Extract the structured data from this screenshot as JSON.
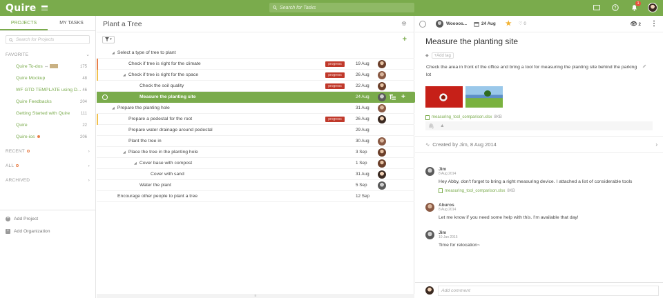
{
  "app": {
    "logo": "Quire",
    "search_placeholder": "Search for Tasks",
    "notification_count": "1"
  },
  "colors": {
    "brand": "#7aab4c",
    "progress_tag": "#c0392b",
    "favorite_dot": "#e8804a"
  },
  "sidebar": {
    "tabs": [
      "PROJECTS",
      "MY TASKS"
    ],
    "search_placeholder": "Search for Projects",
    "favorite_header": "FAVORITE",
    "projects": [
      {
        "name": "Quire To-dos",
        "count": "175"
      },
      {
        "name": "Quire Mockup",
        "count": "48"
      },
      {
        "name": "WF GTD TEMPLATE using D...",
        "count": "46"
      },
      {
        "name": "Quire Feedbacks",
        "count": "204"
      },
      {
        "name": "Getting Started with Quire",
        "count": "111"
      },
      {
        "name": "Quire",
        "count": "22"
      },
      {
        "name": "Quire-ios",
        "count": "206"
      }
    ],
    "sections": [
      "RECENT",
      "ALL",
      "ARCHIVED"
    ],
    "footer": {
      "add_project": "Add Project",
      "add_organization": "Add Organization"
    }
  },
  "main": {
    "title": "Plant a Tree",
    "tasks": [
      {
        "name": "Select a type of tree to plant",
        "tag": "",
        "date": ""
      },
      {
        "name": "Check if tree is right for the climate",
        "tag": "progress",
        "date": "19 Aug"
      },
      {
        "name": "Check if tree is right for the space",
        "tag": "progress",
        "date": "26 Aug"
      },
      {
        "name": "Check the soil quality",
        "tag": "progress",
        "date": "22 Aug"
      },
      {
        "name": "Measure the planting site",
        "tag": "",
        "date": "24 Aug"
      },
      {
        "name": "Prepare the planting hole",
        "tag": "",
        "date": "31 Aug"
      },
      {
        "name": "Prepare a pedestal for the root",
        "tag": "progress",
        "date": "26 Aug"
      },
      {
        "name": "Prepare water drainage around pedestal",
        "tag": "",
        "date": "29 Aug"
      },
      {
        "name": "Plant the tree in",
        "tag": "",
        "date": "30 Aug"
      },
      {
        "name": "Place the tree in the planting hole",
        "tag": "",
        "date": "3 Sep"
      },
      {
        "name": "Cover base with compost",
        "tag": "",
        "date": "1 Sep"
      },
      {
        "name": "Cover with sand",
        "tag": "",
        "date": "31 Aug"
      },
      {
        "name": "Water the plant",
        "tag": "",
        "date": "5 Sep"
      },
      {
        "name": "Encourage other people to plant a tree",
        "tag": "",
        "date": "12 Sep"
      }
    ]
  },
  "detail": {
    "assignee": "Woooos...",
    "due": "24 Aug",
    "likes": "0",
    "followers": "2",
    "title": "Measure the planting site",
    "add_tag": "Add tag",
    "description": "Check the area in front of the office and bring a tool for measuring the planting site behind the parking lot",
    "attachment": {
      "name": "measuring_tool_comparison.xlsx",
      "size": "8KB"
    },
    "created": "Created by Jim, 8 Aug 2014",
    "comments": [
      {
        "author": "Jim",
        "date": "8 Aug 2014",
        "text": "Hey Abby, don't forget to bring a right measuring device. I attached a list of considerable tools",
        "file": "measuring_tool_comparison.xlsx",
        "file_size": "8KB"
      },
      {
        "author": "Aburos",
        "date": "8 Aug 2014",
        "text": "Let me know if you need some help with this. I'm available that day!"
      },
      {
        "author": "Jim",
        "date": "10 Jan 2015",
        "text": "Time for relocation~"
      }
    ],
    "comment_placeholder": "Add comment"
  }
}
